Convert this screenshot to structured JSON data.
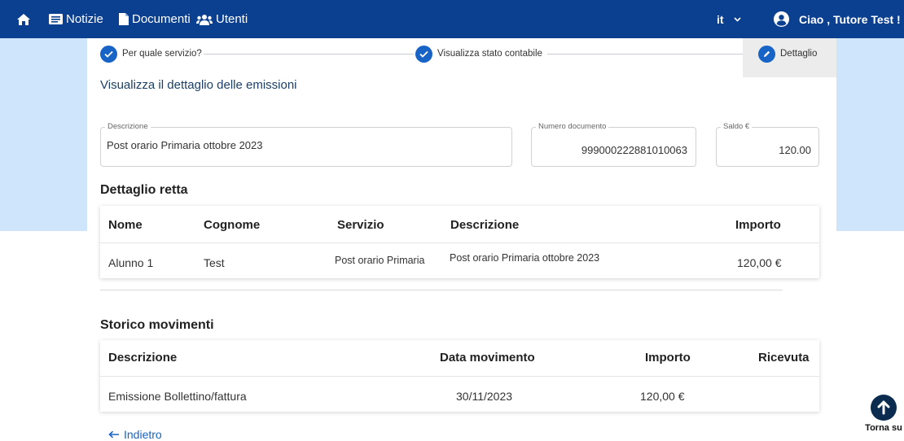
{
  "nav": {
    "items": [
      {
        "label": "Notizie",
        "icon": "newspaper-icon"
      },
      {
        "label": "Documenti",
        "icon": "document-icon"
      },
      {
        "label": "Utenti",
        "icon": "users-icon"
      }
    ],
    "language": "it",
    "user_greeting": "Ciao , Tutore Test !",
    "colors": {
      "bar": "#0b3f8f",
      "accent": "#1763c6",
      "side_band": "#cfe5fb"
    }
  },
  "stepper": {
    "steps": [
      {
        "label": "Per quale servizio?",
        "state": "done"
      },
      {
        "label": "Visualizza stato contabile",
        "state": "done"
      },
      {
        "label": "Dettaglio",
        "state": "active"
      }
    ]
  },
  "page": {
    "title": "Visualizza il dettaglio delle emissioni"
  },
  "fields": {
    "descrizione": {
      "label": "Descrizione",
      "value": "Post orario Primaria ottobre 2023"
    },
    "numero_documento": {
      "label": "Numero documento",
      "value": "999000222881010063"
    },
    "saldo": {
      "label": "Saldo €",
      "value": "120.00"
    }
  },
  "dettaglio_retta": {
    "title": "Dettaglio retta",
    "headers": [
      "Nome",
      "Cognome",
      "Servizio",
      "Descrizione",
      "Importo"
    ],
    "rows": [
      [
        "Alunno 1",
        "Test",
        "Post orario Primaria",
        "Post orario Primaria ottobre 2023",
        "120,00 €"
      ]
    ]
  },
  "storico_movimenti": {
    "title": "Storico movimenti",
    "headers": [
      "Descrizione",
      "Data movimento",
      "Importo",
      "Ricevuta"
    ],
    "rows": [
      [
        "Emissione Bollettino/fattura",
        "30/11/2023",
        "120,00 €",
        ""
      ]
    ]
  },
  "actions": {
    "back_label": "Indietro",
    "to_top_label": "Torna su"
  }
}
